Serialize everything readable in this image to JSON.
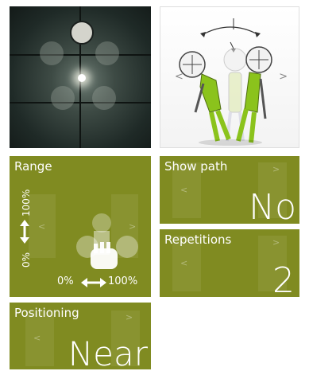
{
  "figure_tile": {
    "left_arrow": "<",
    "right_arrow": ">"
  },
  "range_tile": {
    "title": "Range",
    "vertical_min": "0%",
    "vertical_max": "100%",
    "horizontal_min": "0%",
    "horizontal_max": "100%",
    "left_chevron": "<",
    "right_chevron": ">"
  },
  "show_path_tile": {
    "title": "Show path",
    "value": "No",
    "left_chevron": "<",
    "right_chevron": ">"
  },
  "repetitions_tile": {
    "title": "Repetitions",
    "value": "2",
    "left_chevron": "<",
    "right_chevron": ">"
  },
  "positioning_tile": {
    "title": "Positioning",
    "value": "Near",
    "left_chevron": "<",
    "right_chevron": ">"
  },
  "colors": {
    "tile_olive": "#808b21",
    "figure_green": "#8bc31c"
  }
}
